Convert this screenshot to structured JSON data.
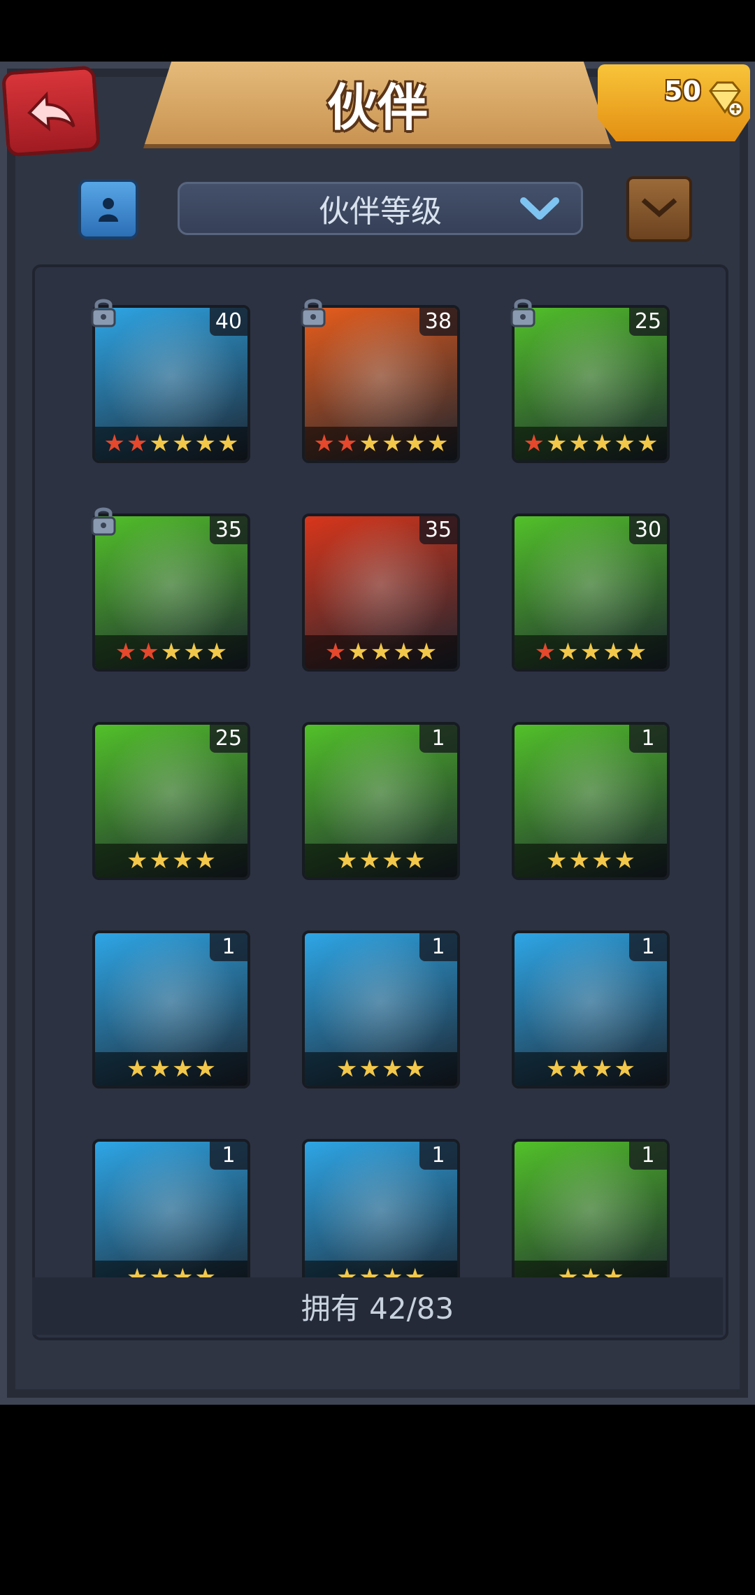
{
  "header": {
    "title": "伙伴",
    "gem_count": "50"
  },
  "toolbar": {
    "sort_label": "伙伴等级"
  },
  "partners": [
    {
      "level": "40",
      "stars_red": 2,
      "stars_gold": 4,
      "locked": true,
      "color": "#2ea6e6"
    },
    {
      "level": "38",
      "stars_red": 2,
      "stars_gold": 4,
      "locked": true,
      "color": "#e85d1c"
    },
    {
      "level": "25",
      "stars_red": 1,
      "stars_gold": 5,
      "locked": true,
      "color": "#52c12a"
    },
    {
      "level": "35",
      "stars_red": 2,
      "stars_gold": 3,
      "locked": true,
      "color": "#52c12a"
    },
    {
      "level": "35",
      "stars_red": 1,
      "stars_gold": 4,
      "locked": false,
      "color": "#d8361b"
    },
    {
      "level": "30",
      "stars_red": 1,
      "stars_gold": 4,
      "locked": false,
      "color": "#52c12a"
    },
    {
      "level": "25",
      "stars_red": 0,
      "stars_gold": 4,
      "locked": false,
      "color": "#52c12a"
    },
    {
      "level": "1",
      "stars_red": 0,
      "stars_gold": 4,
      "locked": false,
      "color": "#52c12a"
    },
    {
      "level": "1",
      "stars_red": 0,
      "stars_gold": 4,
      "locked": false,
      "color": "#52c12a"
    },
    {
      "level": "1",
      "stars_red": 0,
      "stars_gold": 4,
      "locked": false,
      "color": "#2ea6e6"
    },
    {
      "level": "1",
      "stars_red": 0,
      "stars_gold": 4,
      "locked": false,
      "color": "#2ea6e6"
    },
    {
      "level": "1",
      "stars_red": 0,
      "stars_gold": 4,
      "locked": false,
      "color": "#2ea6e6"
    },
    {
      "level": "1",
      "stars_red": 0,
      "stars_gold": 4,
      "locked": false,
      "color": "#2ea6e6"
    },
    {
      "level": "1",
      "stars_red": 0,
      "stars_gold": 4,
      "locked": false,
      "color": "#2ea6e6"
    },
    {
      "level": "1",
      "stars_red": 0,
      "stars_gold": 3,
      "locked": false,
      "color": "#52c12a"
    }
  ],
  "footer": {
    "owned_text": "拥有 42/83"
  }
}
